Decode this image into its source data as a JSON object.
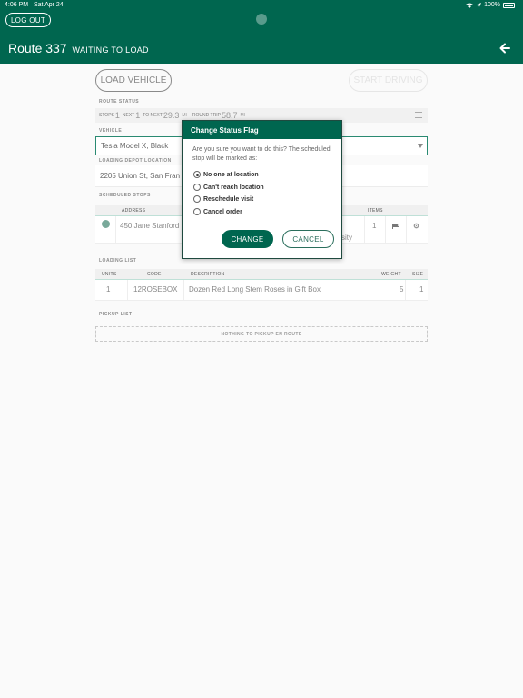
{
  "status_bar": {
    "time": "4:06 PM",
    "date": "Sat Apr 24",
    "battery": "100%"
  },
  "header": {
    "logout_label": "LOG OUT",
    "title": "Route 337",
    "status": "WAITING TO LOAD"
  },
  "actions": {
    "load_vehicle": "LOAD VEHICLE",
    "start_driving": "START DRIVING"
  },
  "route_status": {
    "label": "ROUTE STATUS",
    "stops_label": "STOPS",
    "stops": "1",
    "next_label": "NEXT",
    "next": "1",
    "to_next_label": "TO NEXT",
    "to_next": "29.3",
    "to_next_unit": "MI",
    "round_trip_label": "ROUND TRIP",
    "round_trip": "58.7",
    "round_trip_unit": "MI"
  },
  "vehicle": {
    "label": "VEHICLE",
    "value": "Tesla Model X, Black"
  },
  "depot": {
    "label": "LOADING DEPOT LOCATION",
    "value": "2205 Union St, San Fran"
  },
  "scheduled_stops": {
    "label": "SCHEDULED STOPS",
    "columns": {
      "address": "ADDRESS",
      "items": "ITEMS"
    },
    "rows": [
      {
        "address": "450 Jane Stanford",
        "address_tail": "sity",
        "items": "1"
      }
    ]
  },
  "loading_list": {
    "label": "LOADING LIST",
    "columns": {
      "units": "UNITS",
      "code": "CODE",
      "description": "DESCRIPTION",
      "weight": "WEIGHT",
      "size": "SIZE"
    },
    "rows": [
      {
        "units": "1",
        "code": "12ROSEBOX",
        "description": "Dozen Red Long Stem Roses in Gift Box",
        "weight": "5",
        "size": "1"
      }
    ]
  },
  "pickup_list": {
    "label": "PICKUP LIST",
    "empty": "NOTHING TO PICKUP EN ROUTE"
  },
  "modal": {
    "title": "Change Status Flag",
    "message": "Are you sure you want to do this? The scheduled stop will be marked as:",
    "options": [
      {
        "label": "No one at location",
        "checked": true
      },
      {
        "label": "Can't reach location",
        "checked": false
      },
      {
        "label": "Reschedule visit",
        "checked": false
      },
      {
        "label": "Cancel order",
        "checked": false
      }
    ],
    "change_label": "CHANGE",
    "cancel_label": "CANCEL"
  },
  "colors": {
    "brand": "#00664f",
    "background": "#fafafa"
  },
  "icons": [
    "wifi-icon",
    "location-arrow-icon",
    "battery-icon",
    "back-arrow-icon",
    "menu-icon",
    "chevron-down-icon",
    "flag-icon",
    "gear-icon"
  ]
}
